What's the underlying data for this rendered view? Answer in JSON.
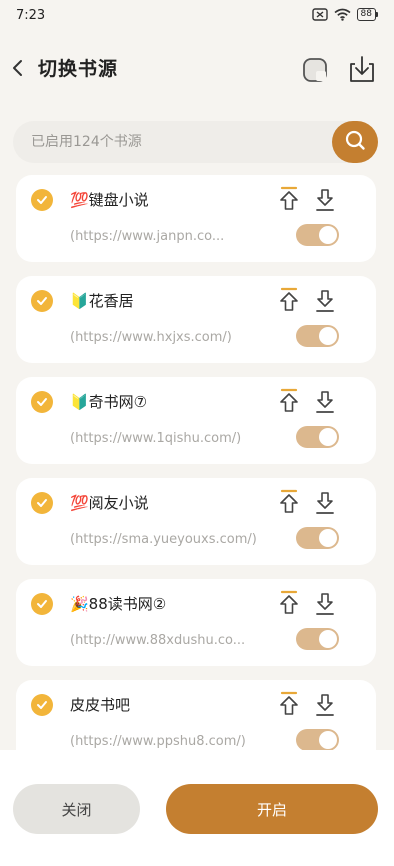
{
  "status_bar": {
    "time": "7:23",
    "battery": "88"
  },
  "header": {
    "title": "切换书源"
  },
  "search": {
    "placeholder": "已启用124个书源"
  },
  "sources": [
    {
      "name": "💯键盘小说",
      "url": "(https://www.janpn.co...",
      "selected": true,
      "enabled": true
    },
    {
      "name": "🔰花香居",
      "url": "(https://www.hxjxs.com/)",
      "selected": true,
      "enabled": true
    },
    {
      "name": "🔰奇书网⑦",
      "url": "(https://www.1qishu.com/)",
      "selected": true,
      "enabled": true
    },
    {
      "name": "💯阅友小说",
      "url": "(https://sma.yueyouxs.com/)",
      "selected": true,
      "enabled": true
    },
    {
      "name": "🎉88读书网②",
      "url": "(http://www.88xdushu.co...",
      "selected": true,
      "enabled": true
    },
    {
      "name": "皮皮书吧",
      "url": "(https://www.ppshu8.com/)",
      "selected": true,
      "enabled": true
    }
  ],
  "bottom": {
    "close_label": "关闭",
    "start_label": "开启"
  },
  "colors": {
    "accent": "#c47f30",
    "check": "#f2b53a",
    "toggle_on": "#dcb88e",
    "background": "#f6f4f0"
  }
}
